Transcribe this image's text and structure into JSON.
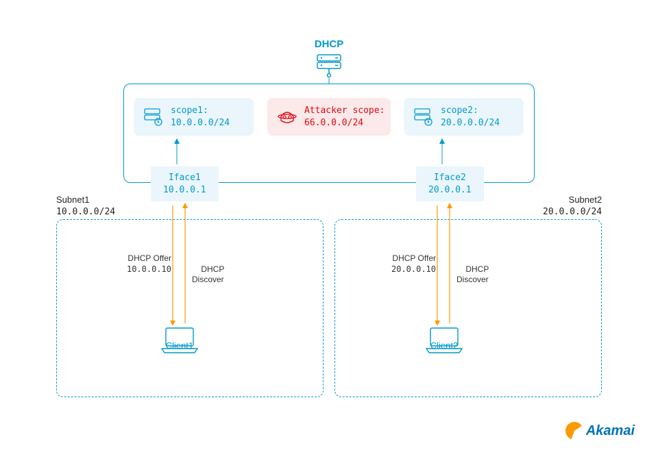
{
  "title": "DHCP",
  "scopes": {
    "scope1": {
      "label": "scope1:",
      "cidr": "10.0.0.0/24"
    },
    "attacker": {
      "label": "Attacker scope:",
      "cidr": "66.0.0.0/24"
    },
    "scope2": {
      "label": "scope2:",
      "cidr": "20.0.0.0/24"
    }
  },
  "ifaces": {
    "iface1": {
      "name": "Iface1",
      "ip": "10.0.0.1"
    },
    "iface2": {
      "name": "Iface2",
      "ip": "20.0.0.1"
    }
  },
  "subnets": {
    "subnet1": {
      "name": "Subnet1",
      "cidr": "10.0.0.0/24"
    },
    "subnet2": {
      "name": "Subnet2",
      "cidr": "20.0.0.0/24"
    }
  },
  "clients": {
    "client1": "Client1",
    "client2": "Client2"
  },
  "flows": {
    "offer1": {
      "title": "DHCP Offer",
      "ip": "10.0.0.10"
    },
    "discover1": {
      "title": "DHCP\nDiscover"
    },
    "offer2": {
      "title": "DHCP Offer",
      "ip": "20.0.0.10"
    },
    "discover2": {
      "title": "DHCP\nDiscover"
    }
  },
  "brand": "Akamai",
  "colors": {
    "blue": "#0099cc",
    "paleBlue": "#eaf6fc",
    "red": "#e30613",
    "paleRed": "#fce9e9",
    "orange": "#ff9900"
  }
}
